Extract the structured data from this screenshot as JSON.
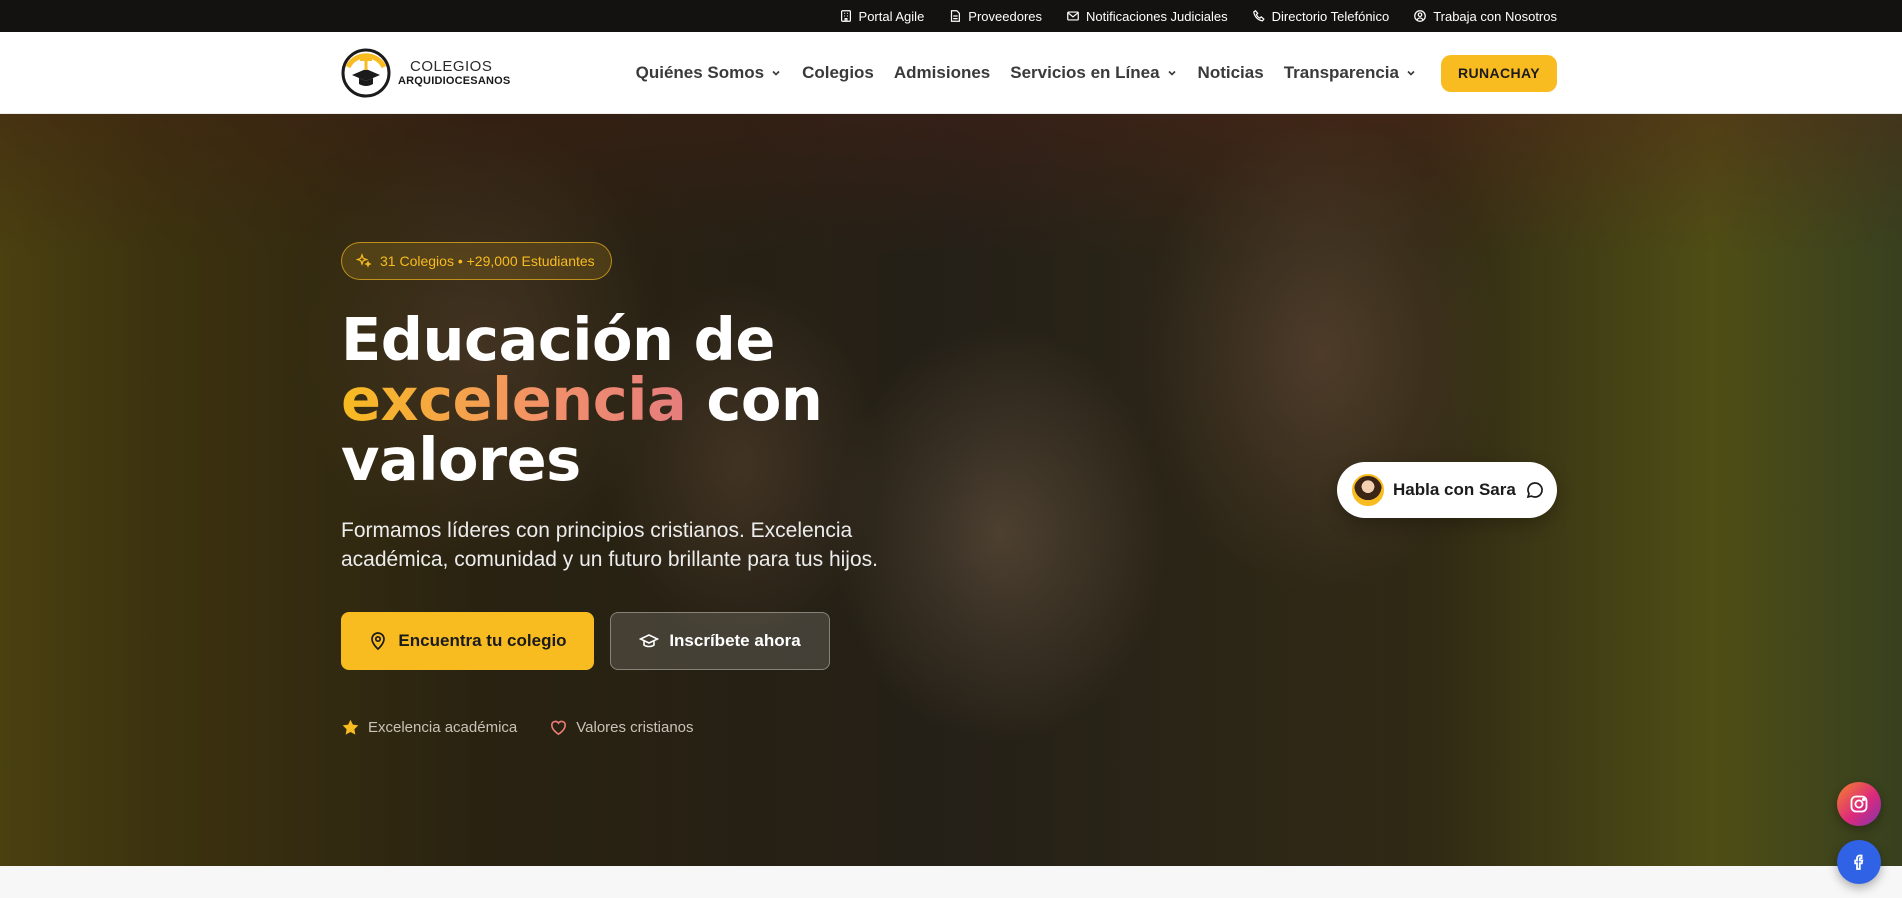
{
  "topbar": {
    "links": [
      {
        "label": "Portal Agile",
        "icon": "building-icon"
      },
      {
        "label": "Proveedores",
        "icon": "document-icon"
      },
      {
        "label": "Notificaciones Judiciales",
        "icon": "mail-icon"
      },
      {
        "label": "Directorio Telefónico",
        "icon": "phone-icon"
      },
      {
        "label": "Trabaja con Nosotros",
        "icon": "user-circle-icon"
      }
    ]
  },
  "header": {
    "logo": {
      "line1": "COLEGIOS",
      "line2": "ARQUIDIOCESANOS"
    },
    "nav": [
      {
        "label": "Quiénes Somos",
        "dropdown": true
      },
      {
        "label": "Colegios",
        "dropdown": false
      },
      {
        "label": "Admisiones",
        "dropdown": false
      },
      {
        "label": "Servicios en Línea",
        "dropdown": true
      },
      {
        "label": "Noticias",
        "dropdown": false
      },
      {
        "label": "Transparencia",
        "dropdown": true
      }
    ],
    "cta_label": "RUNACHAY"
  },
  "hero": {
    "badge": "31 Colegios • +29,000 Estudiantes",
    "title_part1": "Educación de",
    "title_highlight": "excelencia",
    "title_part2": "con",
    "title_part3": "valores",
    "subtitle": "Formamos líderes con principios cristianos. Excelencia académica, comunidad y un futuro brillante para tus hijos.",
    "primary_button": "Encuentra tu colegio",
    "secondary_button": "Inscríbete ahora",
    "features": [
      {
        "label": "Excelencia académica",
        "icon": "star-icon"
      },
      {
        "label": "Valores cristianos",
        "icon": "heart-icon"
      }
    ]
  },
  "chat": {
    "label": "Habla con Sara"
  },
  "colors": {
    "accent": "#f8bb20",
    "topbar_bg": "#141210",
    "instagram": "#dd2a7b",
    "facebook": "#2f62e5"
  }
}
